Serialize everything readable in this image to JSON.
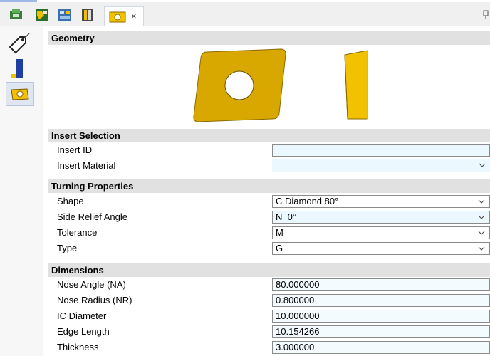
{
  "tabs": [
    {
      "icon": "machine-setup-icon"
    },
    {
      "icon": "tool-assembly-icon"
    },
    {
      "icon": "toolpath-grid-icon"
    },
    {
      "icon": "holder-icon"
    },
    {
      "icon": "insert-icon",
      "active": true,
      "close_label": "×"
    }
  ],
  "sidebar": {
    "items": [
      {
        "icon": "tool-tag-icon"
      },
      {
        "icon": "holder-blue-icon"
      },
      {
        "icon": "insert-icon",
        "active": true
      }
    ]
  },
  "sections": {
    "geometry": "Geometry",
    "insert_selection": "Insert Selection",
    "turning_properties": "Turning Properties",
    "dimensions": "Dimensions"
  },
  "insert_selection": {
    "insert_id": {
      "label": "Insert ID",
      "value": ""
    },
    "insert_material": {
      "label": "Insert Material",
      "value": ""
    }
  },
  "turning_properties": {
    "shape": {
      "label": "Shape",
      "value": "C Diamond 80°"
    },
    "side_relief_angle": {
      "label": "Side Relief Angle",
      "value": "N  0°"
    },
    "tolerance": {
      "label": "Tolerance",
      "value": "M"
    },
    "type": {
      "label": "Type",
      "value": "G"
    }
  },
  "dimensions": {
    "nose_angle": {
      "label": "Nose Angle (NA)",
      "value": "80.000000"
    },
    "nose_radius": {
      "label": "Nose Radius (NR)",
      "value": "0.800000"
    },
    "ic_diameter": {
      "label": "IC Diameter",
      "value": "10.000000"
    },
    "edge_length": {
      "label": "Edge Length",
      "value": "10.154266"
    },
    "thickness": {
      "label": "Thickness",
      "value": "3.000000"
    }
  },
  "colors": {
    "insert_gold": "#d8a800",
    "insert_gold_light": "#f2c200",
    "field_blue": "#ebf8ff",
    "header_gray": "#e1e1e1"
  }
}
